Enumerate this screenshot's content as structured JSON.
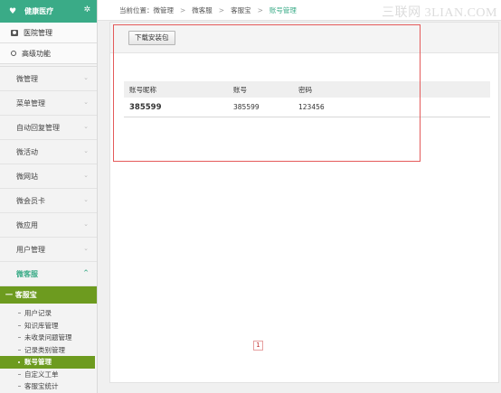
{
  "sidebar": {
    "brand": "健康医疗",
    "top_links": [
      {
        "label": "医院管理",
        "icon": "camera-icon"
      },
      {
        "label": "高级功能",
        "icon": "people-icon"
      }
    ],
    "menu": [
      {
        "label": "微管理"
      },
      {
        "label": "菜单管理"
      },
      {
        "label": "自动回复管理"
      },
      {
        "label": "微活动"
      },
      {
        "label": "微网站"
      },
      {
        "label": "微会员卡"
      },
      {
        "label": "微应用"
      },
      {
        "label": "用户管理"
      },
      {
        "label": "微客服",
        "expanded": true
      }
    ],
    "submenu_header": "一 客服宝",
    "submenu": [
      {
        "label": "用户记录"
      },
      {
        "label": "知识库管理"
      },
      {
        "label": "未收录问题管理"
      },
      {
        "label": "记录类别管理"
      },
      {
        "label": "账号管理",
        "current": true
      },
      {
        "label": "自定义工单"
      },
      {
        "label": "客服宝统计"
      }
    ],
    "chevron_down": "⌄",
    "chevron_up": "^"
  },
  "breadcrumb": {
    "prefix": "当前位置：",
    "items": [
      "微管理",
      "微客服",
      "客服宝",
      "账号管理"
    ],
    "separator": ">"
  },
  "watermark": "三联网 3LIAN.COM",
  "toolbar": {
    "download_label": "下载安装包"
  },
  "table": {
    "headers": [
      "账号昵称",
      "账号",
      "密码"
    ],
    "rows": [
      [
        "385599",
        "385599",
        "123456"
      ]
    ]
  },
  "pager": {
    "current_page": "1"
  },
  "colors": {
    "brand_green": "#3aab87",
    "submenu_green": "#6d9b1f",
    "highlight_red": "#e45a5a"
  }
}
